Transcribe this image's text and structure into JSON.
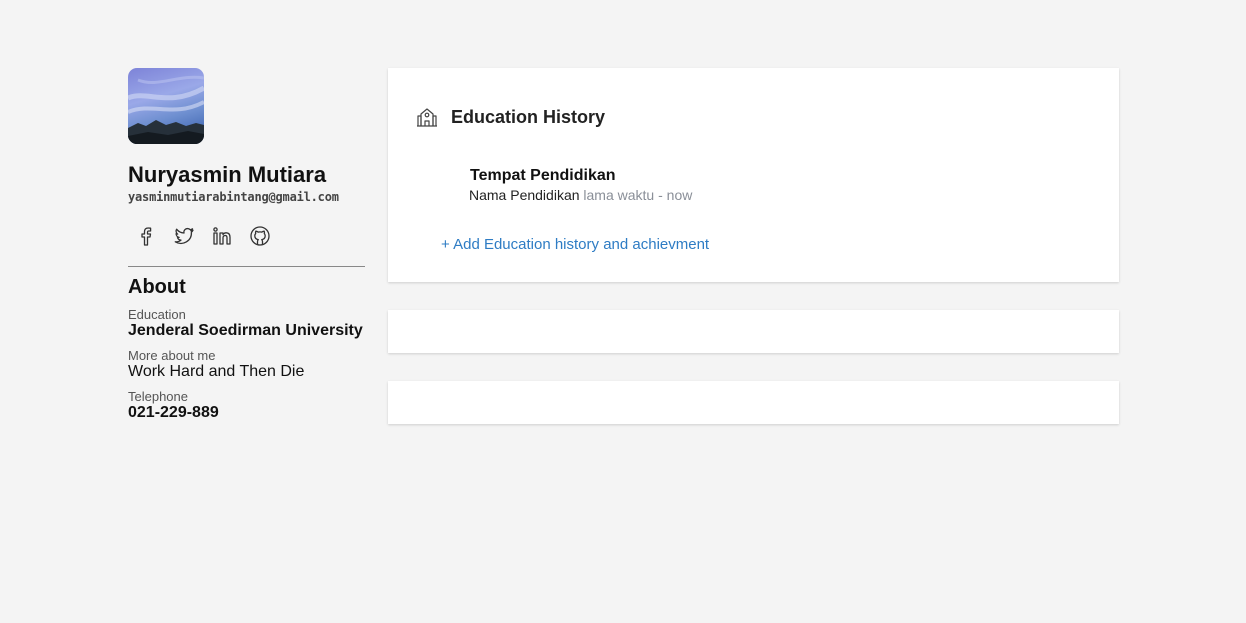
{
  "profile": {
    "name": "Nuryasmin Mutiara",
    "email": "yasminmutiarabintang@gmail.com",
    "socials": [
      "facebook-icon",
      "twitter-icon",
      "linkedin-icon",
      "github-icon"
    ]
  },
  "about": {
    "title": "About",
    "fields": [
      {
        "label": "Education",
        "value": "Jenderal Soedirman University"
      },
      {
        "label": "More about me",
        "value": "Work Hard and Then Die"
      },
      {
        "label": "Telephone",
        "value": "021-229-889"
      }
    ]
  },
  "education": {
    "icon": "school-icon",
    "title": "Education History",
    "items": [
      {
        "place": "Tempat Pendidikan",
        "name": "Nama Pendidikan",
        "time": "lama waktu - now"
      }
    ],
    "add_label": "+ Add Education history and achievment"
  },
  "colors": {
    "background": "#f4f4f4",
    "card": "#ffffff",
    "link": "#2e7cc4",
    "muted": "#8a8f98"
  }
}
